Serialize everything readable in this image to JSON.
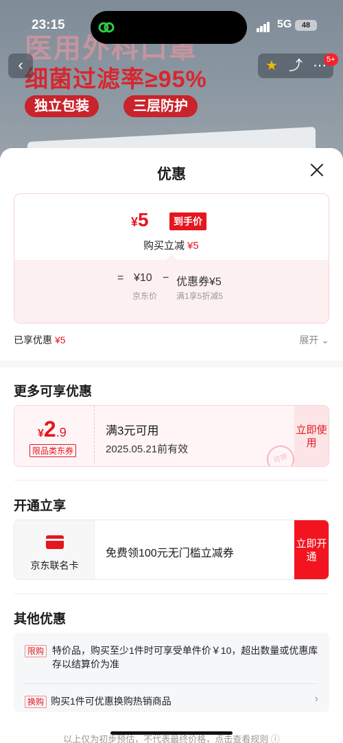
{
  "status_bar": {
    "time": "23:15",
    "network": "5G",
    "battery": "48"
  },
  "hero": {
    "line1": "医用外科口罩",
    "line2": "细菌过滤率≥95%",
    "pills": [
      "独立包装",
      "三层防护"
    ]
  },
  "nav": {
    "cart_badge": "5+"
  },
  "sheet": {
    "title": "优惠",
    "price_card": {
      "currency": "¥",
      "final_price": "5",
      "final_tag": "到手价",
      "reduce_label": "购买立减",
      "reduce_amount": "¥5",
      "formula_eq": "=",
      "jd_price": "¥10",
      "minus": "−",
      "coupon_label": "优惠券¥5",
      "jd_price_label": "京东价",
      "coupon_desc": "满1享5折减5"
    },
    "enjoyed_label": "已享优惠",
    "enjoyed_amount": "¥5",
    "expand_label": "展开 ⌄"
  },
  "more_offers": {
    "heading": "更多可享优惠",
    "coupon": {
      "currency": "¥",
      "amount_int": "2",
      "amount_dec": ".9",
      "kind": "限品类东券",
      "condition": "满3元可用",
      "expiry": "2025.05.21前有效",
      "action": "立即使用",
      "stamp": "可领"
    }
  },
  "open_enjoy": {
    "heading": "开通立享",
    "card_name": "京东联名卡",
    "description": "免费领100元无门槛立减券",
    "action": "立即开通"
  },
  "other_offers": {
    "heading": "其他优惠",
    "items": [
      {
        "tag": "限购",
        "text": "特价品，购买至少1件时可享受单件价￥10，超出数量或优惠库存以结算价为准"
      },
      {
        "tag": "换购",
        "text": "购买1件可优惠换购热销商品"
      }
    ],
    "footnote": "以上仅为初步预估，不代表最终价格，点击查看规则 ⓘ"
  },
  "colors": {
    "accent": "#e4161e",
    "accent_light": "#fdf0f1"
  }
}
